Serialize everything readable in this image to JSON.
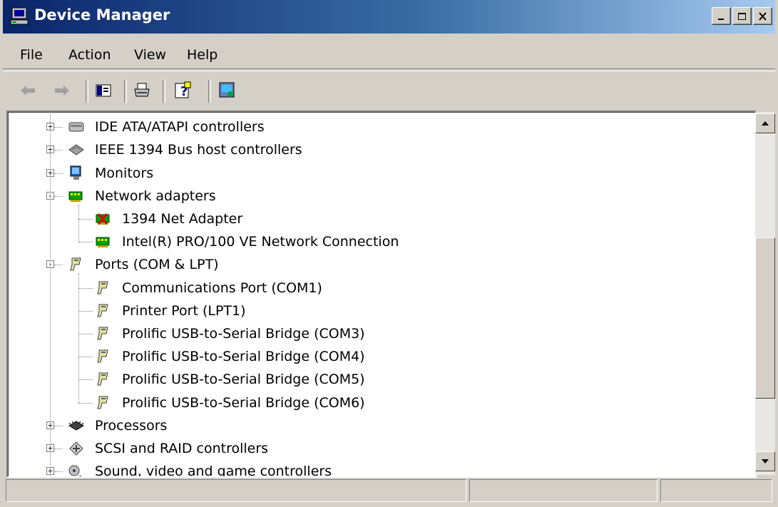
{
  "window": {
    "title": "Device Manager"
  },
  "menu": [
    {
      "label": "File"
    },
    {
      "label": "Action"
    },
    {
      "label": "View"
    },
    {
      "label": "Help"
    }
  ],
  "toolbar": [
    {
      "icon": "back-arrow-icon"
    },
    {
      "icon": "forward-arrow-icon"
    },
    {
      "icon": "show-hide-console-tree-icon"
    },
    {
      "icon": "print-icon"
    },
    {
      "icon": "help-icon"
    },
    {
      "icon": "scan-hardware-icon"
    }
  ],
  "tree": [
    {
      "label": "IDE ATA/ATAPI controllers",
      "level": 0,
      "expander": "+",
      "icon": "ide-controller-icon"
    },
    {
      "label": "IEEE 1394 Bus host controllers",
      "level": 0,
      "expander": "+",
      "icon": "ieee1394-icon"
    },
    {
      "label": "Monitors",
      "level": 0,
      "expander": "+",
      "icon": "monitor-icon"
    },
    {
      "label": "Network adapters",
      "level": 0,
      "expander": "-",
      "icon": "network-adapter-icon"
    },
    {
      "label": "1394 Net Adapter",
      "level": 1,
      "icon": "network-adapter-disabled-icon"
    },
    {
      "label": "Intel(R) PRO/100 VE Network Connection",
      "level": 1,
      "icon": "network-adapter-icon"
    },
    {
      "label": "Ports (COM & LPT)",
      "level": 0,
      "expander": "-",
      "icon": "port-icon"
    },
    {
      "label": "Communications Port (COM1)",
      "level": 1,
      "icon": "port-icon"
    },
    {
      "label": "Printer Port (LPT1)",
      "level": 1,
      "icon": "port-icon"
    },
    {
      "label": "Prolific USB-to-Serial Bridge (COM3)",
      "level": 1,
      "icon": "port-icon"
    },
    {
      "label": "Prolific USB-to-Serial Bridge (COM4)",
      "level": 1,
      "icon": "port-icon"
    },
    {
      "label": "Prolific USB-to-Serial Bridge (COM5)",
      "level": 1,
      "icon": "port-icon"
    },
    {
      "label": "Prolific USB-to-Serial Bridge (COM6)",
      "level": 1,
      "icon": "port-icon"
    },
    {
      "label": "Processors",
      "level": 0,
      "expander": "+",
      "icon": "processor-icon"
    },
    {
      "label": "SCSI and RAID controllers",
      "level": 0,
      "expander": "+",
      "icon": "scsi-icon"
    },
    {
      "label": "Sound, video and game controllers",
      "level": 0,
      "expander": "+",
      "icon": "sound-icon"
    }
  ],
  "status": [
    "",
    "",
    ""
  ],
  "colors": {
    "title_start": "#0a246a",
    "title_end": "#a6caf0",
    "face": "#d4d0c8"
  }
}
